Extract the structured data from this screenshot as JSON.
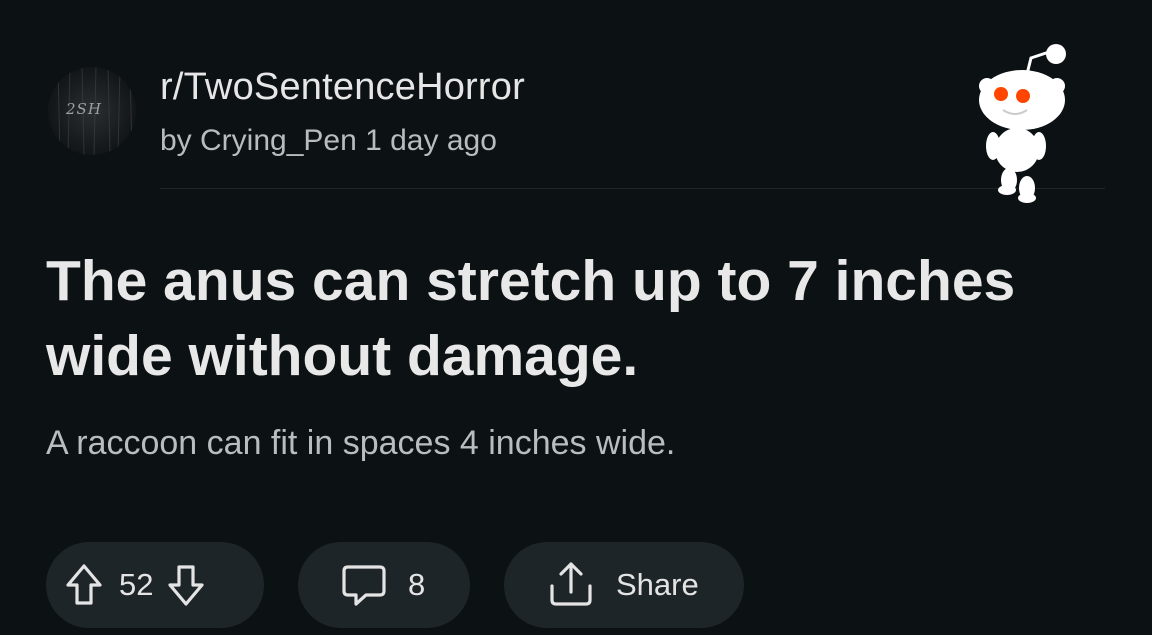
{
  "post": {
    "subreddit": "r/TwoSentenceHorror",
    "meta": "by Crying_Pen 1 day ago",
    "avatar_text": "2SH",
    "title": "The anus can stretch up to 7 inches wide without damage.",
    "body": "A raccoon can fit in spaces 4 inches wide."
  },
  "actions": {
    "votes": "52",
    "comments": "8",
    "share_label": "Share"
  },
  "icons": {
    "upvote": "arrow-up-icon",
    "downvote": "arrow-down-icon",
    "comment": "speech-bubble-icon",
    "share": "share-icon",
    "mascot": "snoo-mascot"
  },
  "colors": {
    "background": "#0c1114",
    "pill": "#1e2528",
    "snoo_eyes": "#ff4500"
  }
}
